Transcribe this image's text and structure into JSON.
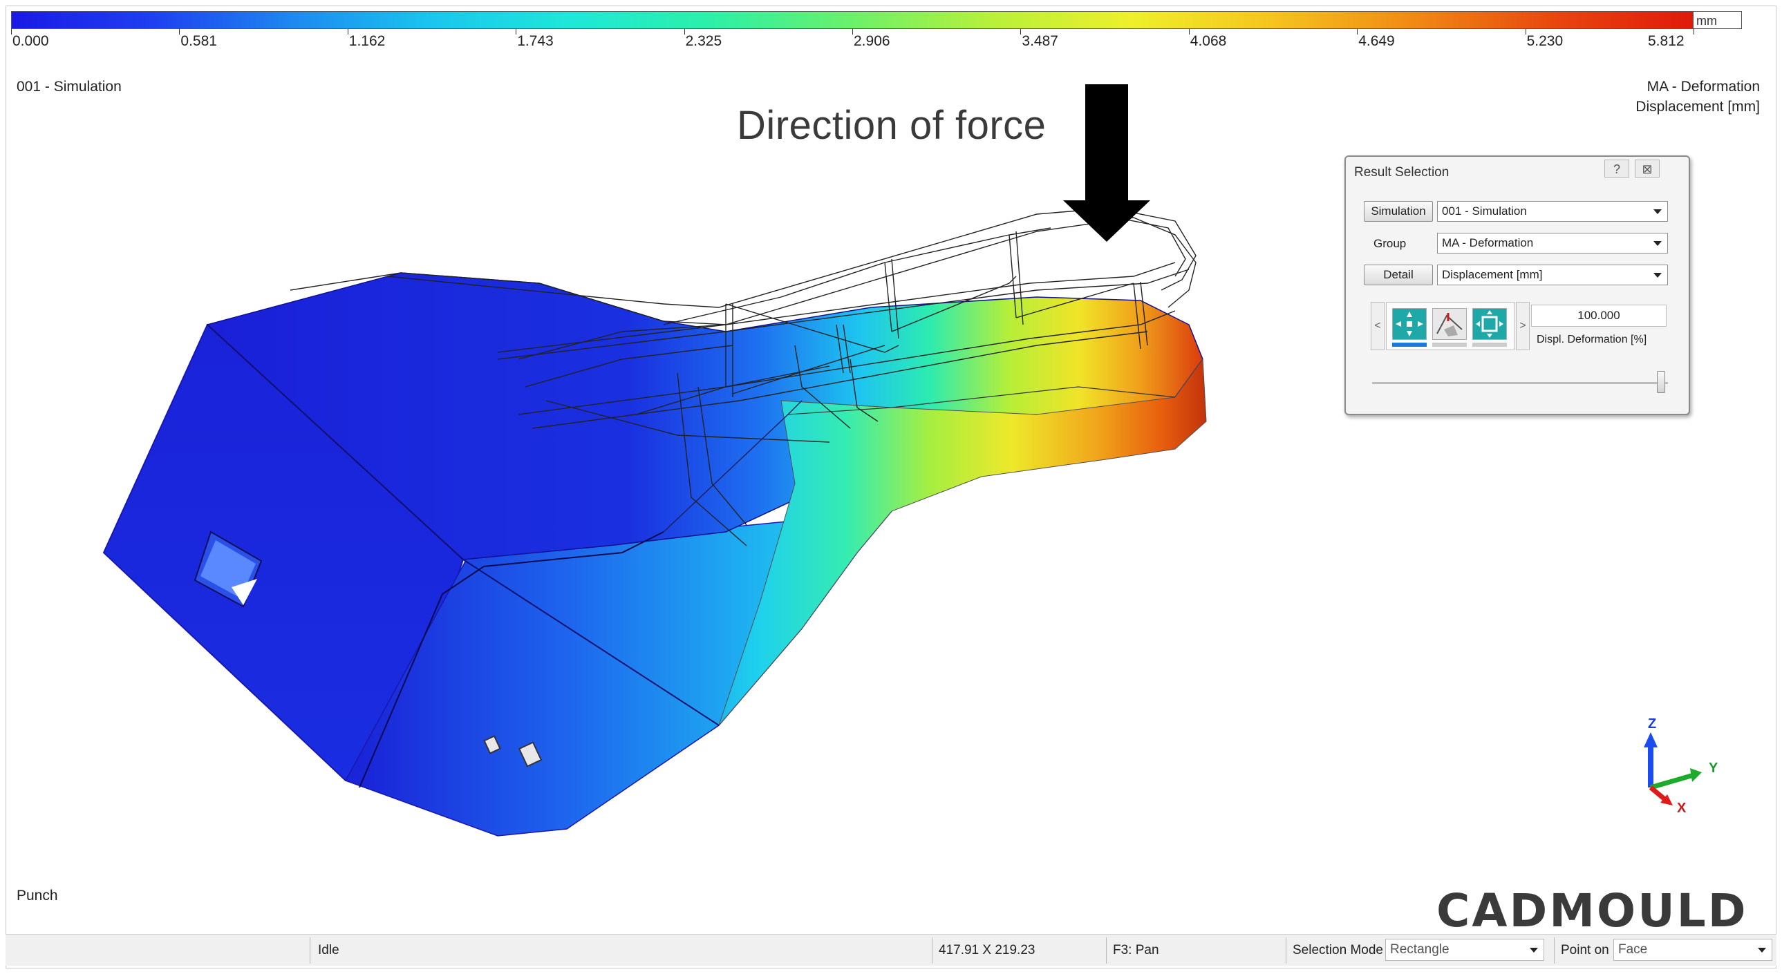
{
  "legend": {
    "unit": "mm",
    "tick_labels": [
      "0.000",
      "0.581",
      "1.162",
      "1.743",
      "2.325",
      "2.906",
      "3.487",
      "4.068",
      "4.649",
      "5.230",
      "5.812"
    ],
    "color_stops": [
      "#1a1ae6",
      "#1f3ff0",
      "#1e88f0",
      "#19c6ee",
      "#1ee8d8",
      "#2cf0a8",
      "#6cf06a",
      "#b8f03a",
      "#eef02a",
      "#f5c41e",
      "#f08a14",
      "#e8480e",
      "#e01a0a"
    ]
  },
  "viewport": {
    "simulation_name": "001 - Simulation",
    "result_title": "MA - Deformation",
    "result_subtitle": "Displacement [mm]",
    "part_name": "Punch",
    "annotation": "Direction of force"
  },
  "axis_triad": {
    "z": "Z",
    "y": "Y",
    "x": "X"
  },
  "dialog": {
    "title": "Result Selection",
    "help": "?",
    "close": "⊠",
    "simulation_btn": "Simulation",
    "simulation_value": "001 - Simulation",
    "group_label": "Group",
    "group_value": "MA - Deformation",
    "detail_btn": "Detail",
    "detail_value": "Displacement [mm]",
    "nav_prev": "<",
    "nav_next": ">",
    "deformation_value": "100.000",
    "deformation_label": "Displ. Deformation [%]"
  },
  "statusbar": {
    "state": "Idle",
    "coords": "417.91 X 219.23",
    "hint": "F3: Pan",
    "selection_mode_label": "Selection Mode",
    "selection_mode_value": "Rectangle",
    "point_on_label": "Point on",
    "point_on_value": "Face"
  },
  "logo": "CADMOULD"
}
